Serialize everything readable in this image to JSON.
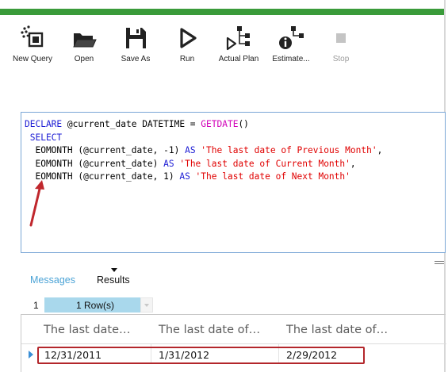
{
  "colors": {
    "accent_green": "#3a9b3a",
    "keyword_blue": "#1b1bd4",
    "function_magenta": "#d100b8",
    "string_red": "#e00000",
    "tab_link_blue": "#4ba3d6",
    "rowcount_fill": "#a9d8ec",
    "highlight_red": "#b3262b"
  },
  "toolbar": {
    "items": [
      {
        "label": "New Query",
        "icon": "new-query-icon",
        "enabled": true
      },
      {
        "label": "Open",
        "icon": "folder-open-icon",
        "enabled": true
      },
      {
        "label": "Save As",
        "icon": "floppy-disk-icon",
        "enabled": true
      },
      {
        "label": "Run",
        "icon": "play-icon",
        "enabled": true
      },
      {
        "label": "Actual Plan",
        "icon": "actual-plan-icon",
        "enabled": true
      },
      {
        "label": "Estimate...",
        "icon": "estimated-plan-icon",
        "enabled": true
      },
      {
        "label": "Stop",
        "icon": "stop-icon",
        "enabled": false
      }
    ]
  },
  "editor": {
    "lines": [
      [
        {
          "t": "DECLARE",
          "c": "kw"
        },
        {
          "t": " @current_date DATETIME = ",
          "c": ""
        },
        {
          "t": "GETDATE",
          "c": "fn"
        },
        {
          "t": "()",
          "c": ""
        }
      ],
      [
        {
          "t": " SELECT",
          "c": "kw"
        }
      ],
      [
        {
          "t": "  EOMONTH (@current_date, -1) ",
          "c": ""
        },
        {
          "t": "AS",
          "c": "kw"
        },
        {
          "t": " 'The last date of Previous Month'",
          "c": "str"
        },
        {
          "t": ",",
          "c": ""
        }
      ],
      [
        {
          "t": "  EOMONTH (@current_date) ",
          "c": ""
        },
        {
          "t": "AS",
          "c": "kw"
        },
        {
          "t": " 'The last date of Current Month'",
          "c": "str"
        },
        {
          "t": ",",
          "c": ""
        }
      ],
      [
        {
          "t": "  EOMONTH (@current_date, 1) ",
          "c": ""
        },
        {
          "t": "AS",
          "c": "kw"
        },
        {
          "t": " 'The last date of Next Month'",
          "c": "str"
        }
      ]
    ]
  },
  "results_panel": {
    "tabs": {
      "messages_label": "Messages",
      "results_label": "Results"
    },
    "result_set": {
      "number": "1",
      "row_count_label": "1 Row(s)"
    },
    "grid": {
      "columns": [
        "The last date…",
        "The last date of…",
        "The last date of…"
      ],
      "rows": [
        [
          "12/31/2011",
          "1/31/2012",
          "2/29/2012"
        ]
      ]
    }
  }
}
